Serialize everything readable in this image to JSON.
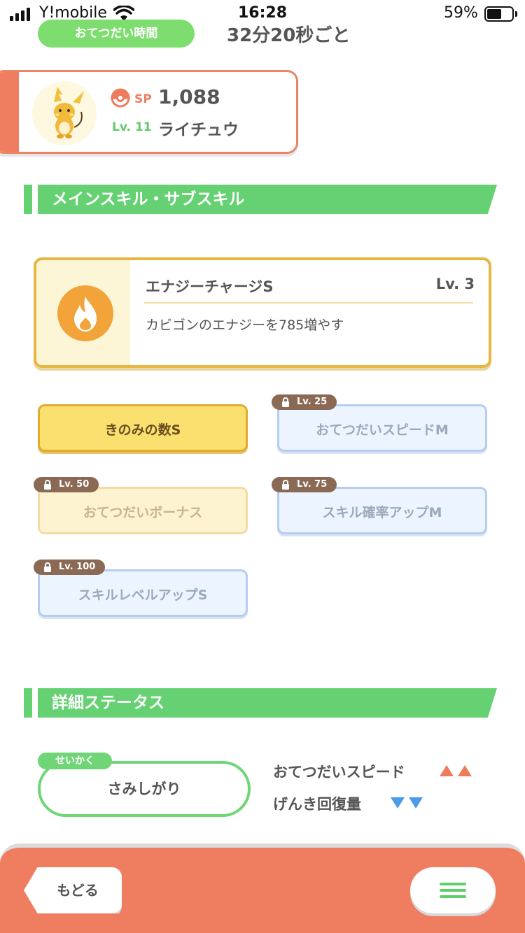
{
  "status_bar": {
    "carrier": "Y!mobile",
    "time": "16:28",
    "battery_percent": "59%",
    "battery_level": 0.59
  },
  "header": {
    "help_time_label": "おてつだい時間",
    "help_time_value": "32分20秒ごと"
  },
  "pokemon": {
    "sp_label": "SP",
    "sp_value": "1,088",
    "level": "Lv. 11",
    "name": "ライチュウ"
  },
  "skills_section": {
    "title": "メインスキル・サブスキル",
    "main_skill": {
      "name": "エナジーチャージS",
      "level": "Lv. 3",
      "description": "カビゴンのエナジーを785増やす",
      "icon": "flame-icon"
    },
    "sub_skills": [
      {
        "label": "きのみの数S",
        "lock_level": ""
      },
      {
        "label": "おてつだいスピードM",
        "lock_level": "Lv. 25"
      },
      {
        "label": "おてつだいボーナス",
        "lock_level": "Lv. 50"
      },
      {
        "label": "スキル確率アップM",
        "lock_level": "Lv. 75"
      },
      {
        "label": "スキルレベルアップS",
        "lock_level": "Lv. 100"
      }
    ]
  },
  "status_section": {
    "title": "詳細ステータス",
    "nature_tag": "せいかく",
    "nature_value": "さみしがり",
    "effects": [
      {
        "label": "おてつだいスピード",
        "direction": "up",
        "color": "#ee7b5c"
      },
      {
        "label": "げんき回復量",
        "direction": "down",
        "color": "#4b9be8"
      }
    ]
  },
  "footer": {
    "back_label": "もどる",
    "menu_icon": "hamburger-menu-icon"
  },
  "colors": {
    "accent_green": "#65d173",
    "accent_orange": "#ef7e60",
    "gold": "#e6b743"
  }
}
